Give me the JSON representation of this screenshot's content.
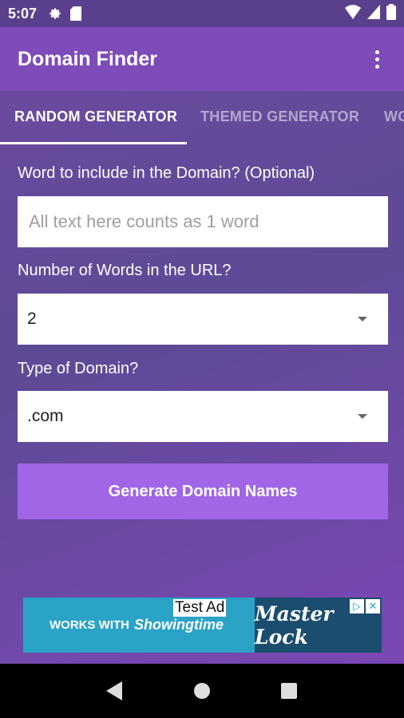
{
  "status_bar": {
    "time": "5:07"
  },
  "app_bar": {
    "title": "Domain Finder"
  },
  "tabs": [
    {
      "label": "RANDOM GENERATOR",
      "active": true
    },
    {
      "label": "THEMED GENERATOR",
      "active": false
    },
    {
      "label": "WO",
      "active": false
    }
  ],
  "form": {
    "word_label": "Word to include in the Domain? (Optional)",
    "word_placeholder": "All text here counts as 1 word",
    "word_value": "",
    "count_label": "Number of Words in the URL?",
    "count_value": "2",
    "type_label": "Type of Domain?",
    "type_value": ".com",
    "generate_label": "Generate Domain Names"
  },
  "ad": {
    "label": "Test Ad",
    "left_text": "WORKS WITH",
    "brand_left": "Showingtime",
    "brand_right": "Master Lock"
  },
  "colors": {
    "status_bar": "#5a3f8c",
    "app_bar": "#7e4bb8",
    "button": "#a066e6",
    "ad_blue": "#2aa3c6"
  }
}
